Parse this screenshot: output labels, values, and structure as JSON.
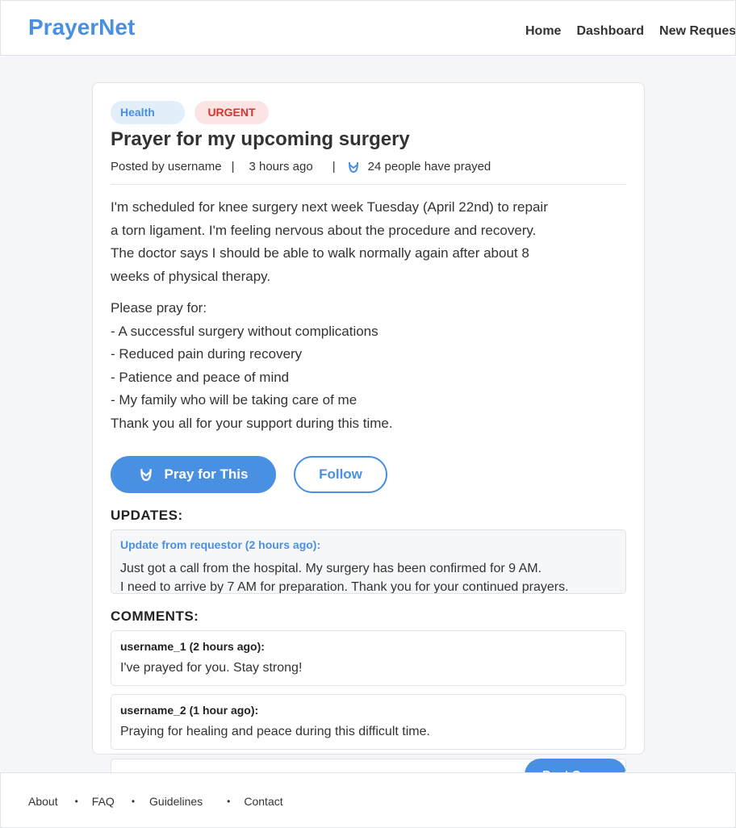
{
  "header": {
    "logo": "PrayerNet",
    "nav": [
      "Home",
      "Dashboard",
      "New Request"
    ]
  },
  "post": {
    "tags": [
      "Health",
      "URGENT"
    ],
    "title": "Prayer for my upcoming surgery",
    "meta": {
      "posted_by": "Posted by username",
      "separator": "|",
      "time": "3 hours ago",
      "prayed_count": "24 people have prayed"
    },
    "body_lines": [
      "I'm scheduled for knee surgery next week Tuesday (April 22nd) to repair",
      "a torn ligament. I'm feeling nervous about the procedure and recovery.",
      "The doctor says I should be able to walk normally again after about 8",
      "weeks of physical therapy."
    ],
    "pray_for_lines": [
      "Please pray for:",
      "- A successful surgery without complications",
      "- Reduced pain during recovery",
      "- Patience and peace of mind",
      "- My family who will be taking care of me",
      "Thank you all for your support during this time."
    ]
  },
  "actions": {
    "pray_label": "Pray for This",
    "follow_label": "Follow"
  },
  "updates": {
    "title": "UPDATES:",
    "items": [
      {
        "head": "Update from requestor (2 hours ago):",
        "lines": [
          "Just got a call from the hospital. My surgery has been confirmed for 9 AM.",
          "I need to arrive by 7 AM for preparation. Thank you for your continued prayers."
        ]
      }
    ]
  },
  "comments": {
    "title": "COMMENTS:",
    "items": [
      {
        "head": "username_1 (2 hours ago):",
        "text": "I've prayed for you. Stay strong!"
      },
      {
        "head": "username_2 (1 hour ago):",
        "text": "Praying for healing and peace during this difficult time."
      }
    ],
    "post_label": "Post Comment"
  },
  "footer": {
    "links": [
      "About",
      "FAQ",
      "Guidelines",
      "Contact"
    ],
    "separator": "•"
  },
  "colors": {
    "accent": "#4a90e2",
    "urgent": "#d9342b",
    "background": "#f4f6f9"
  }
}
